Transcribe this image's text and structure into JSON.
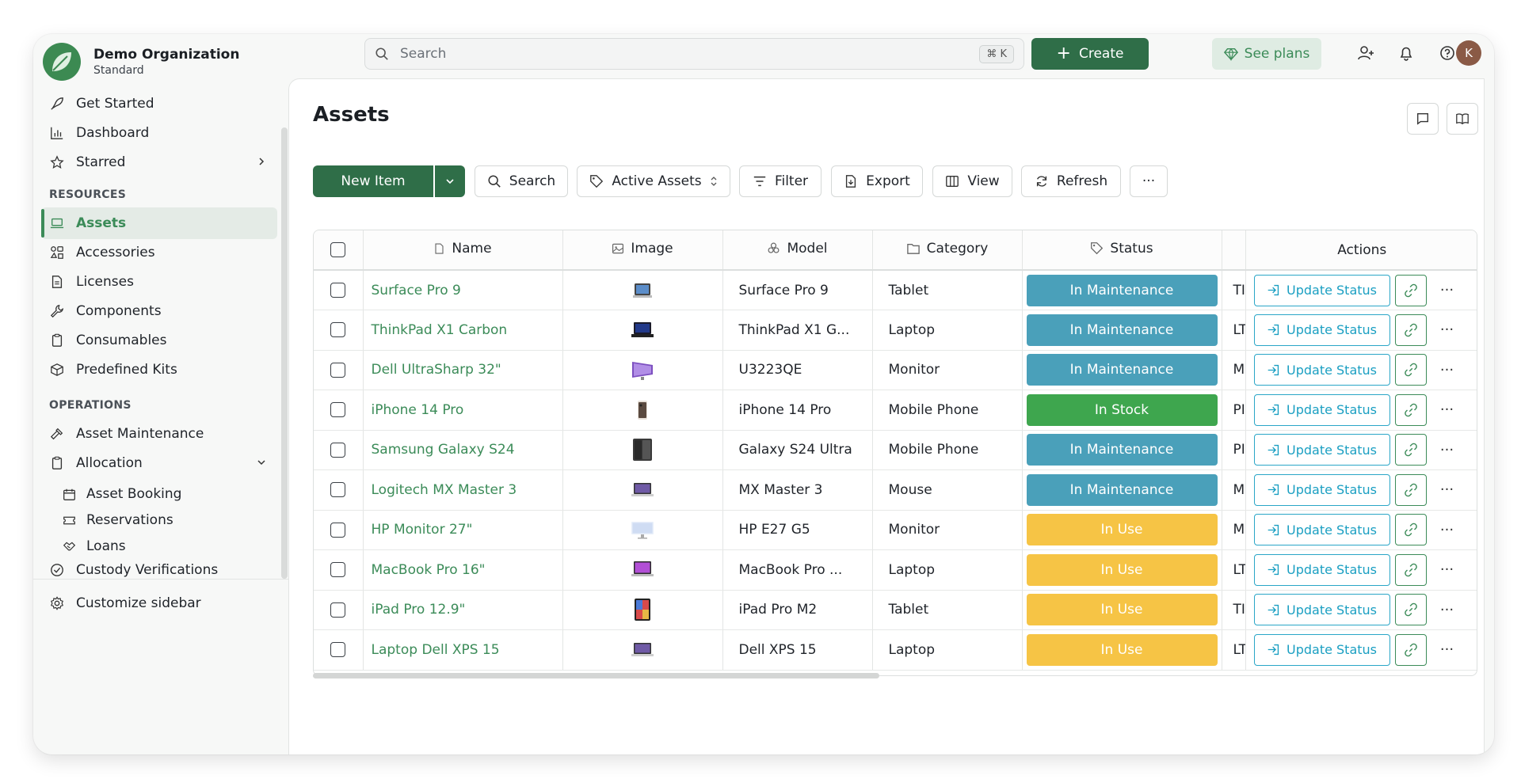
{
  "org": {
    "name": "Demo Organization",
    "plan": "Standard"
  },
  "topbar": {
    "search_placeholder": "Search",
    "shortcut": "⌘ K",
    "create_label": "Create",
    "see_plans_label": "See plans"
  },
  "user": {
    "initial": "K"
  },
  "sidebar": {
    "items": [
      {
        "label": "Get Started",
        "icon": "rocket-icon"
      },
      {
        "label": "Dashboard",
        "icon": "bar-chart-icon"
      },
      {
        "label": "Starred",
        "icon": "star-icon"
      }
    ],
    "resources_label": "RESOURCES",
    "resources": [
      {
        "label": "Assets",
        "icon": "laptop-icon",
        "active": true
      },
      {
        "label": "Accessories",
        "icon": "accessories-icon"
      },
      {
        "label": "Licenses",
        "icon": "file-icon"
      },
      {
        "label": "Components",
        "icon": "wrench-icon"
      },
      {
        "label": "Consumables",
        "icon": "clipboard-icon"
      },
      {
        "label": "Predefined Kits",
        "icon": "box-icon"
      }
    ],
    "operations_label": "OPERATIONS",
    "operations": [
      {
        "label": "Asset Maintenance",
        "icon": "hammer-icon"
      },
      {
        "label": "Allocation",
        "icon": "clipboard-icon"
      }
    ],
    "allocation_sub": [
      {
        "label": "Asset Booking",
        "icon": "calendar-icon"
      },
      {
        "label": "Reservations",
        "icon": "ticket-icon"
      },
      {
        "label": "Loans",
        "icon": "handshake-icon"
      }
    ],
    "custody_label": "Custody Verifications",
    "customize_label": "Customize sidebar"
  },
  "page": {
    "title": "Assets",
    "toolbar": {
      "new_item": "New Item",
      "search": "Search",
      "active_assets": "Active Assets",
      "filter": "Filter",
      "export": "Export",
      "view": "View",
      "refresh": "Refresh",
      "more": "···"
    }
  },
  "table": {
    "columns": {
      "name": "Name",
      "image": "Image",
      "model": "Model",
      "category": "Category",
      "status": "Status",
      "actions": "Actions"
    },
    "action_label": "Update Status",
    "rows": [
      {
        "name": "Surface Pro 9",
        "model": "Surface Pro 9",
        "category": "Tablet",
        "status": "In Maintenance",
        "status_kind": "maintenance",
        "extra": "TI",
        "thumb": "tablet"
      },
      {
        "name": "ThinkPad X1 Carbon",
        "model": "ThinkPad X1 G...",
        "category": "Laptop",
        "status": "In Maintenance",
        "status_kind": "maintenance",
        "extra": "LT",
        "thumb": "laptop-dark"
      },
      {
        "name": "Dell UltraSharp 32\"",
        "model": "U3223QE",
        "category": "Monitor",
        "status": "In Maintenance",
        "status_kind": "maintenance",
        "extra": "M",
        "thumb": "monitor-purple"
      },
      {
        "name": "iPhone 14 Pro",
        "model": "iPhone 14 Pro",
        "category": "Mobile Phone",
        "status": "In Stock",
        "status_kind": "stock",
        "extra": "PI",
        "thumb": "phone"
      },
      {
        "name": "Samsung Galaxy S24",
        "model": "Galaxy S24 Ultra",
        "category": "Mobile Phone",
        "status": "In Maintenance",
        "status_kind": "maintenance",
        "extra": "PI",
        "thumb": "phone-dark"
      },
      {
        "name": "Logitech MX Master 3",
        "model": "MX Master 3",
        "category": "Mouse",
        "status": "In Maintenance",
        "status_kind": "maintenance",
        "extra": "M",
        "thumb": "laptop"
      },
      {
        "name": "HP Monitor 27\"",
        "model": "HP E27 G5",
        "category": "Monitor",
        "status": "In Use",
        "status_kind": "use",
        "extra": "M",
        "thumb": "monitor-light"
      },
      {
        "name": "MacBook Pro 16\"",
        "model": "MacBook Pro ...",
        "category": "Laptop",
        "status": "In Use",
        "status_kind": "use",
        "extra": "LT",
        "thumb": "laptop-purple"
      },
      {
        "name": "iPad Pro 12.9\"",
        "model": "iPad Pro M2",
        "category": "Tablet",
        "status": "In Use",
        "status_kind": "use",
        "extra": "TI",
        "thumb": "tablet-color"
      },
      {
        "name": "Laptop Dell XPS 15",
        "model": "Dell XPS 15",
        "category": "Laptop",
        "status": "In Use",
        "status_kind": "use",
        "extra": "LT",
        "thumb": "laptop"
      }
    ]
  },
  "colors": {
    "brand": "#2f6e48",
    "link": "#3b8b58",
    "maintenance": "#4aa0ba",
    "stock": "#3ea64e",
    "use": "#f6c445",
    "action": "#1a9fc2"
  }
}
